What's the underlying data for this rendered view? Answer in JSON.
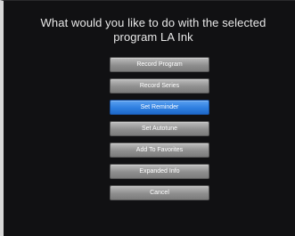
{
  "dialog": {
    "prompt_line1": "What would you like to do with the selected",
    "prompt_line2": "program LA Ink"
  },
  "menu": {
    "selected_index": 2,
    "items": [
      {
        "label": "Record Program"
      },
      {
        "label": "Record Series"
      },
      {
        "label": "Set Reminder"
      },
      {
        "label": "Set Autotune"
      },
      {
        "label": "Add To Favorites"
      },
      {
        "label": "Expanded Info"
      },
      {
        "label": "Cancel"
      }
    ]
  },
  "colors": {
    "background": "#111113",
    "text": "#e8e8e8",
    "button_gray": "#9a9a9a",
    "button_selected": "#2f7fe0"
  }
}
